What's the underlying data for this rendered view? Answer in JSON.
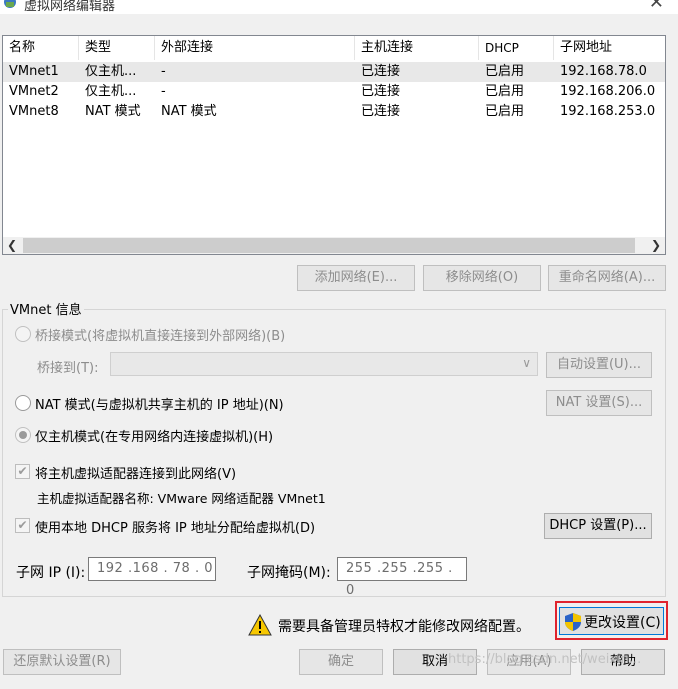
{
  "window": {
    "title": "虚拟网络编辑器",
    "close_glyph": "✕"
  },
  "table": {
    "headers": [
      "名称",
      "类型",
      "外部连接",
      "主机连接",
      "DHCP",
      "子网地址"
    ],
    "rows": [
      [
        "VMnet1",
        "仅主机...",
        "-",
        "已连接",
        "已启用",
        "192.168.78.0"
      ],
      [
        "VMnet2",
        "仅主机...",
        "-",
        "已连接",
        "已启用",
        "192.168.206.0"
      ],
      [
        "VMnet8",
        "NAT 模式",
        "NAT 模式",
        "已连接",
        "已启用",
        "192.168.253.0"
      ]
    ]
  },
  "list_buttons": {
    "add": "添加网络(E)...",
    "remove": "移除网络(O)",
    "rename": "重命名网络(A)..."
  },
  "vmnet_info": {
    "title": "VMnet 信息",
    "bridge_mode": "桥接模式(将虚拟机直接连接到外部网络)(B)",
    "bridge_to": "桥接到(T):",
    "auto_settings": "自动设置(U)...",
    "nat_mode": "NAT 模式(与虚拟机共享主机的 IP 地址)(N)",
    "nat_settings": "NAT 设置(S)...",
    "host_only": "仅主机模式(在专用网络内连接虚拟机)(H)",
    "connect_adapter": "将主机虚拟适配器连接到此网络(V)",
    "adapter_name": "主机虚拟适配器名称: VMware 网络适配器 VMnet1",
    "use_dhcp": "使用本地 DHCP 服务将 IP 地址分配给虚拟机(D)",
    "dhcp_settings": "DHCP 设置(P)...",
    "subnet_ip_label": "子网 IP (I):",
    "subnet_ip": "192 .168 . 78  .  0",
    "subnet_mask_label": "子网掩码(M):",
    "subnet_mask": "255 .255 .255 .  0"
  },
  "admin_notice": "需要具备管理员特权才能修改网络配置。",
  "change_settings": "更改设置(C)",
  "footer": {
    "restore": "还原默认设置(R)",
    "ok": "确定",
    "cancel": "取消",
    "apply": "应用(A)",
    "help": "帮助"
  },
  "watermark": "https://blog.csdn.net/weixin..."
}
